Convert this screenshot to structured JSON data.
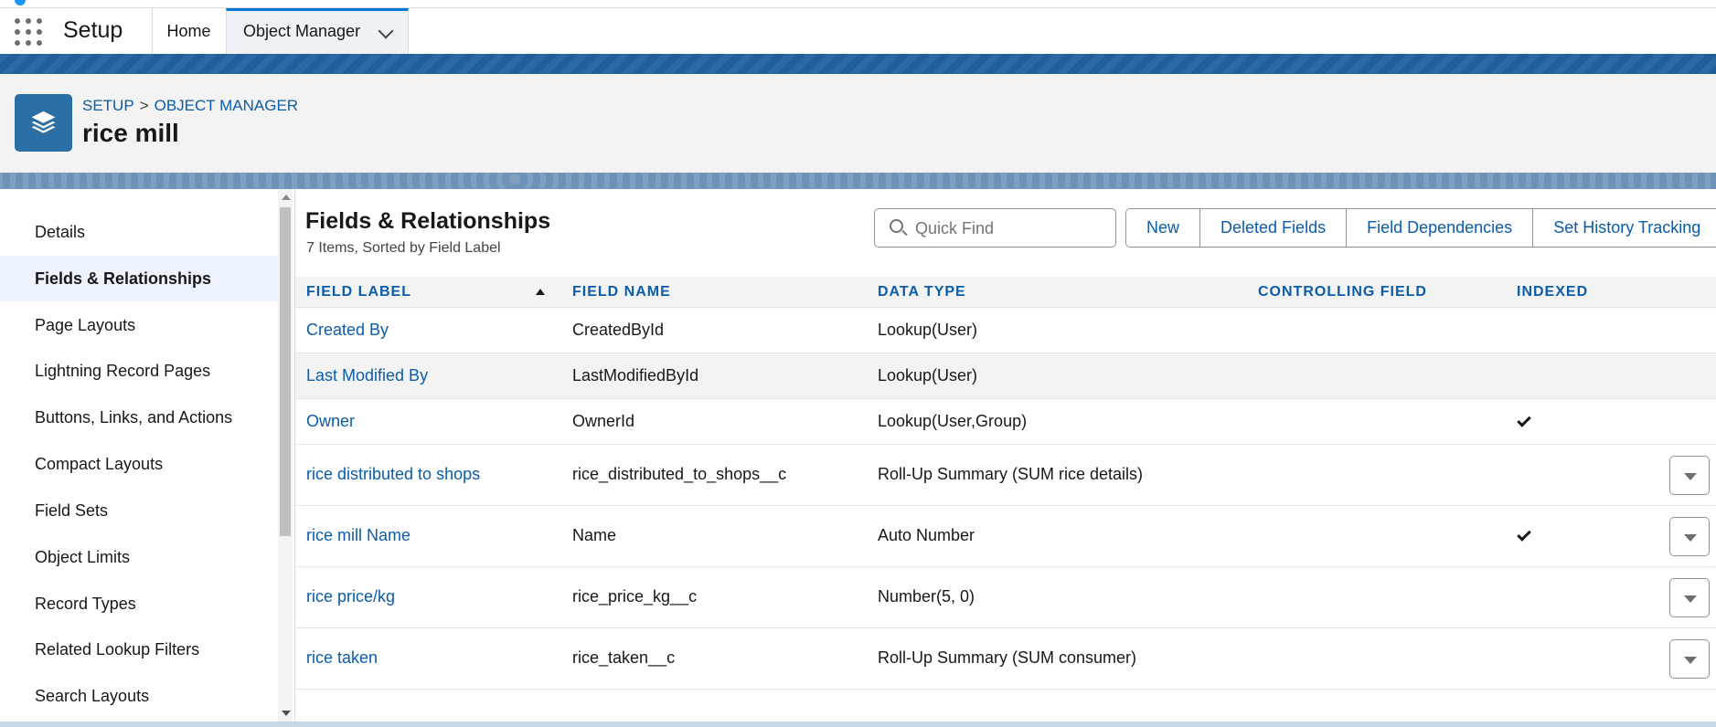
{
  "nav": {
    "app_name": "Setup",
    "tabs": [
      {
        "label": "Home"
      },
      {
        "label": "Object Manager"
      }
    ]
  },
  "header": {
    "breadcrumb": [
      "SETUP",
      "OBJECT MANAGER"
    ],
    "breadcrumb_separator": ">",
    "title": "rice mill"
  },
  "sidebar": {
    "items": [
      {
        "label": "Details"
      },
      {
        "label": "Fields & Relationships"
      },
      {
        "label": "Page Layouts"
      },
      {
        "label": "Lightning Record Pages"
      },
      {
        "label": "Buttons, Links, and Actions"
      },
      {
        "label": "Compact Layouts"
      },
      {
        "label": "Field Sets"
      },
      {
        "label": "Object Limits"
      },
      {
        "label": "Record Types"
      },
      {
        "label": "Related Lookup Filters"
      },
      {
        "label": "Search Layouts"
      }
    ],
    "active_index": 1
  },
  "main": {
    "title": "Fields & Relationships",
    "subtitle": "7 Items, Sorted by Field Label",
    "quick_find_placeholder": "Quick Find",
    "buttons": {
      "new": "New",
      "deleted_fields": "Deleted Fields",
      "field_dependencies": "Field Dependencies",
      "set_history_tracking": "Set History Tracking"
    },
    "columns": [
      "FIELD LABEL",
      "FIELD NAME",
      "DATA TYPE",
      "CONTROLLING FIELD",
      "INDEXED"
    ],
    "rows": [
      {
        "label": "Created By",
        "name": "CreatedById",
        "type": "Lookup(User)",
        "controlling": "",
        "indexed": false
      },
      {
        "label": "Last Modified By",
        "name": "LastModifiedById",
        "type": "Lookup(User)",
        "controlling": "",
        "indexed": false
      },
      {
        "label": "Owner",
        "name": "OwnerId",
        "type": "Lookup(User,Group)",
        "controlling": "",
        "indexed": true
      },
      {
        "label": "rice distributed to shops",
        "name": "rice_distributed_to_shops__c",
        "type": "Roll-Up Summary (SUM rice details)",
        "controlling": "",
        "indexed": false
      },
      {
        "label": "rice mill Name",
        "name": "Name",
        "type": "Auto Number",
        "controlling": "",
        "indexed": true
      },
      {
        "label": "rice price/kg",
        "name": "rice_price_kg__c",
        "type": "Number(5, 0)",
        "controlling": "",
        "indexed": false
      },
      {
        "label": "rice taken",
        "name": "rice_taken__c",
        "type": "Roll-Up Summary (SUM consumer)",
        "controlling": "",
        "indexed": false
      }
    ]
  },
  "colors": {
    "brand_blue": "#0b5cab",
    "accent_band": "#1f5f9c",
    "object_icon": "#2a6fa5"
  }
}
